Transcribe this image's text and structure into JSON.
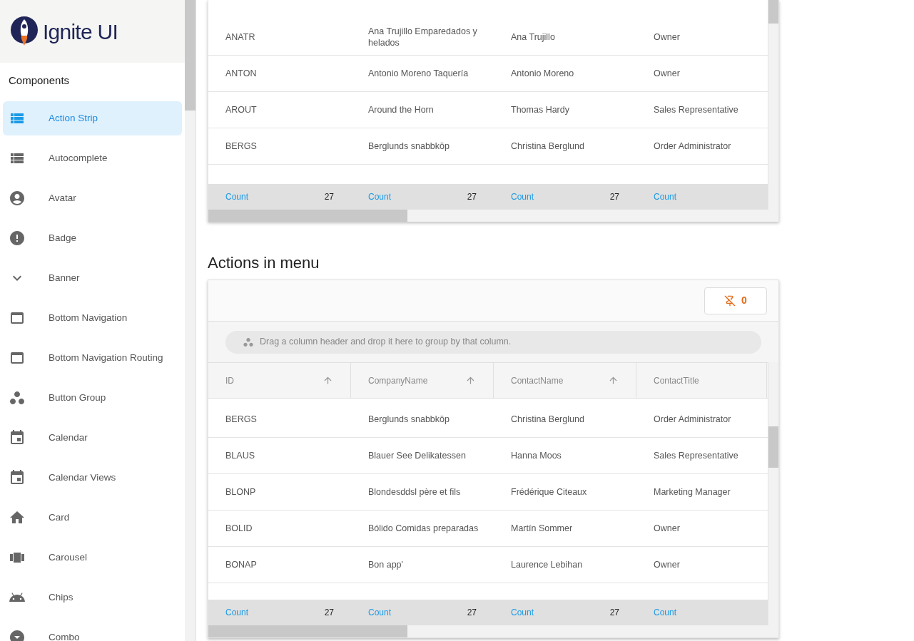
{
  "sidebar": {
    "logo_text": "Ignite UI",
    "section_title": "Components",
    "items": [
      {
        "label": "Action Strip",
        "selected": true
      },
      {
        "label": "Autocomplete",
        "selected": false
      },
      {
        "label": "Avatar",
        "selected": false
      },
      {
        "label": "Badge",
        "selected": false
      },
      {
        "label": "Banner",
        "selected": false
      },
      {
        "label": "Bottom Navigation",
        "selected": false
      },
      {
        "label": "Bottom Navigation Routing",
        "selected": false
      },
      {
        "label": "Button Group",
        "selected": false
      },
      {
        "label": "Calendar",
        "selected": false
      },
      {
        "label": "Calendar Views",
        "selected": false
      },
      {
        "label": "Card",
        "selected": false
      },
      {
        "label": "Carousel",
        "selected": false
      },
      {
        "label": "Chips",
        "selected": false
      },
      {
        "label": "Combo",
        "selected": false
      }
    ]
  },
  "grid_top": {
    "rows": [
      [
        "ANATR",
        "Ana Trujillo Emparedados y helados",
        "Ana Trujillo",
        "Owner"
      ],
      [
        "ANTON",
        "Antonio Moreno Taquería",
        "Antonio Moreno",
        "Owner"
      ],
      [
        "AROUT",
        "Around the Horn",
        "Thomas Hardy",
        "Sales Representative"
      ],
      [
        "BERGS",
        "Berglunds snabbköp",
        "Christina Berglund",
        "Order Administrator"
      ]
    ],
    "summaries": [
      {
        "label": "Count",
        "value": "27"
      },
      {
        "label": "Count",
        "value": "27"
      },
      {
        "label": "Count",
        "value": "27"
      },
      {
        "label": "Count"
      }
    ]
  },
  "section_heading": "Actions in menu",
  "grid_menu": {
    "pinned_button": {
      "count": "0"
    },
    "group_area": {
      "placeholder": "Drag a column header and drop it here to group by that column."
    },
    "columns": [
      {
        "label": "ID",
        "sortable": true
      },
      {
        "label": "CompanyName",
        "sortable": true
      },
      {
        "label": "ContactName",
        "sortable": true
      },
      {
        "label": "ContactTitle",
        "sortable": false
      }
    ],
    "rows": [
      [
        "BERGS",
        "Berglunds snabbköp",
        "Christina Berglund",
        "Order Administrator"
      ],
      [
        "BLAUS",
        "Blauer See Delikatessen",
        "Hanna Moos",
        "Sales Representative"
      ],
      [
        "BLONP",
        "Blondesddsl père et fils",
        "Frédérique Citeaux",
        "Marketing Manager"
      ],
      [
        "BOLID",
        "Bólido Comidas preparadas",
        "Martín Sommer",
        "Owner"
      ],
      [
        "BONAP",
        "Bon app'",
        "Laurence Lebihan",
        "Owner"
      ]
    ],
    "summaries": [
      {
        "label": "Count",
        "value": "27"
      },
      {
        "label": "Count",
        "value": "27"
      },
      {
        "label": "Count",
        "value": "27"
      },
      {
        "label": "Count"
      }
    ]
  }
}
